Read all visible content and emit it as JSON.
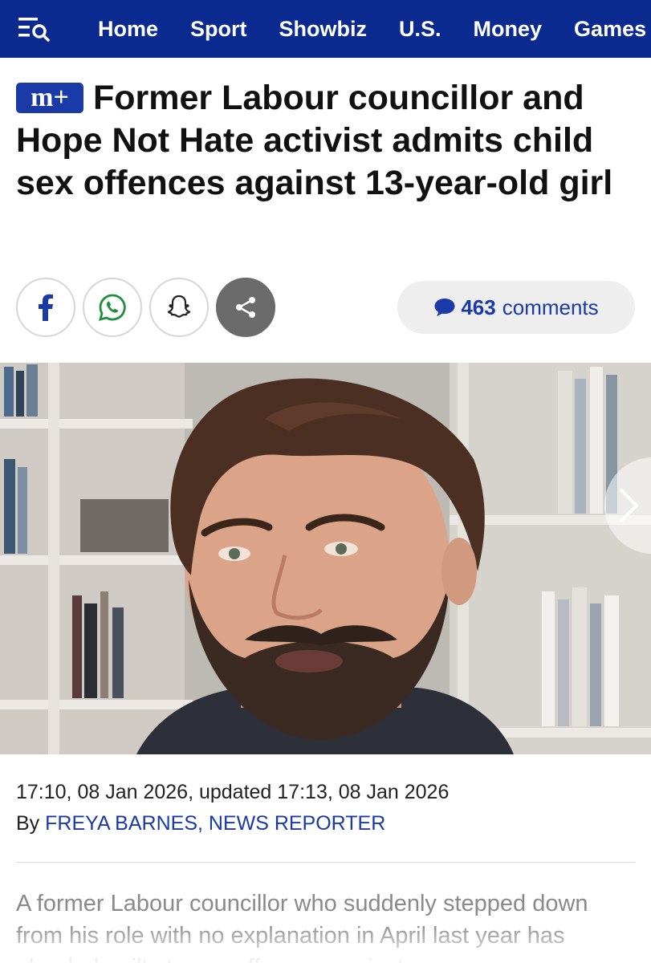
{
  "nav": {
    "items": [
      "Home",
      "Sport",
      "Showbiz",
      "U.S.",
      "Money",
      "Games"
    ]
  },
  "article": {
    "badge": "m+",
    "headline": "Former Labour councillor and Hope Not Hate activist admits child sex offences against 13-year-old girl",
    "timestamp": "17:10, 08 Jan 2026, updated 17:13, 08 Jan 2026",
    "byline_prefix": "By ",
    "author": "FREYA BARNES, NEWS REPORTER",
    "intro": "A former Labour councillor who suddenly stepped down from his role with no explanation in April last year has pleaded guilty to sex offences against a"
  },
  "share": {
    "buttons": [
      "facebook-icon",
      "whatsapp-icon",
      "snapchat-icon",
      "share-icon"
    ],
    "comments_count": "463",
    "comments_label": "comments"
  },
  "colors": {
    "nav_bg": "#0b2a8f",
    "accent": "#1a3aa8",
    "share_more_bg": "#6b6b6b"
  }
}
